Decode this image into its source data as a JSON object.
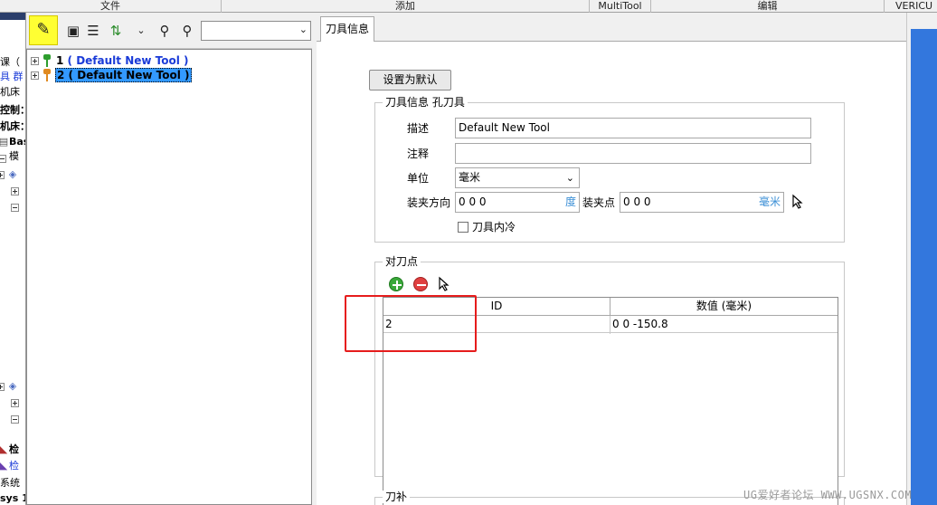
{
  "ribbon": {
    "tabs": [
      "文件",
      "添加",
      "MultiTool",
      "编辑",
      "VERICU"
    ]
  },
  "left_strip": {
    "items": [
      "课（",
      "具 群",
      "机床",
      "控制：",
      "机床：",
      "Bas",
      "模",
      "检",
      "检",
      "系统",
      "sys 1"
    ]
  },
  "toolbar": {
    "combo_value": ""
  },
  "tree": {
    "items": [
      {
        "num": "1",
        "label": "( Default New Tool )",
        "color": "#2e9e2e",
        "selected": false
      },
      {
        "num": "2",
        "label": "( Default New Tool )",
        "color": "#e08a20",
        "selected": true
      }
    ]
  },
  "tabs": {
    "active": "刀具信息"
  },
  "form": {
    "set_default_label": "设置为默认",
    "info_group_title": "刀具信息 孔刀具",
    "desc_label": "描述",
    "desc_value": "Default New Tool",
    "note_label": "注释",
    "note_value": "",
    "unit_label": "单位",
    "unit_value": "毫米",
    "clamp_dir_label": "装夹方向",
    "clamp_dir_value": "0 0 0",
    "clamp_dir_unit": "度",
    "clamp_pt_label": "装夹点",
    "clamp_pt_value": "0 0 0",
    "clamp_pt_unit": "毫米",
    "coolant_label": "刀具内冷",
    "coolant_checked": false
  },
  "offset_group": {
    "title": "对刀点",
    "columns": [
      "ID",
      "数值 (毫米)"
    ],
    "rows": [
      {
        "id": "2",
        "value": "0 0 -150.8"
      }
    ]
  },
  "comp_group": {
    "title": "刀补"
  },
  "watermark": "UG爱好者论坛 WWW.UGSNX.COM"
}
